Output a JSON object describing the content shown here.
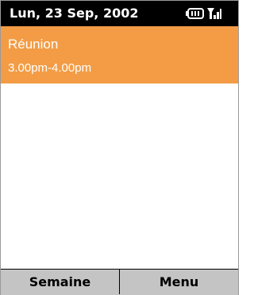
{
  "status_bar": {
    "date": "Lun, 23 Sep, 2002",
    "battery_icon": "battery-icon",
    "signal_icon": "signal-strength-icon"
  },
  "appointment": {
    "title": "Réunion",
    "time": "3.00pm-4.00pm",
    "highlight_color": "#f39c45"
  },
  "softkeys": {
    "left": "Semaine",
    "right": "Menu"
  }
}
